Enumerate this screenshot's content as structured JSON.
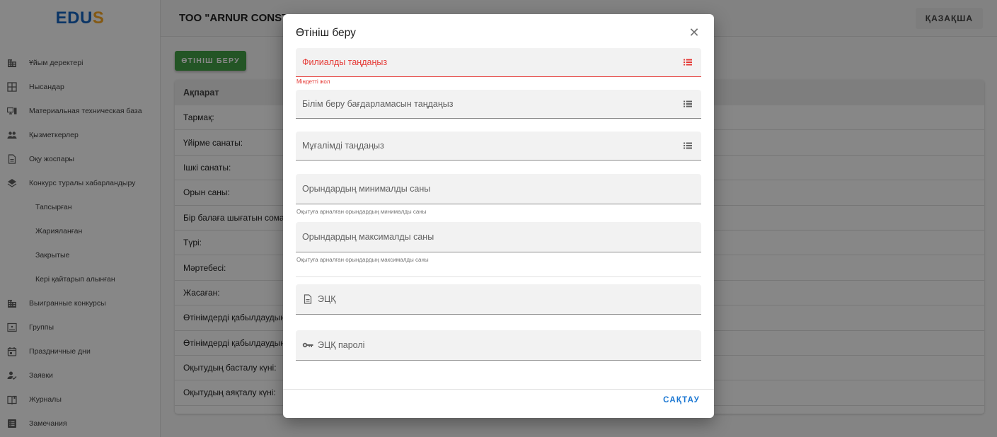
{
  "logo": {
    "e": "E",
    "d": "D",
    "u": "U",
    "s": "S"
  },
  "topbar": {
    "org_title": "ТОО \"ARNUR CONSTRUCTION\"",
    "lang_label": "ҚАЗАҚША"
  },
  "sidebar": {
    "items": [
      {
        "label": "Ұйым деректері",
        "icon": "building-icon"
      },
      {
        "label": "Нысандар",
        "icon": "grid-icon"
      },
      {
        "label": "Материальная техническая база",
        "icon": "devices-icon"
      },
      {
        "label": "Қызметкерлер",
        "icon": "people-icon"
      },
      {
        "label": "Оқу жоспары",
        "icon": "document-icon"
      },
      {
        "label": "Конкурс туралы хабарландыру",
        "icon": "layers-icon"
      },
      {
        "label": "Тапсырған",
        "sub": true
      },
      {
        "label": "Жарияланған",
        "sub": true
      },
      {
        "label": "Закрытые",
        "sub": true
      },
      {
        "label": "Кері қайтарып алынған",
        "sub": true
      },
      {
        "label": "Выигранные конкурсы",
        "icon": "building-icon"
      },
      {
        "label": "Группы",
        "icon": "class-icon"
      },
      {
        "label": "Праздничные дни",
        "icon": "calendar-icon"
      },
      {
        "label": "Заявки",
        "icon": "person-check-icon"
      },
      {
        "label": "Журналы",
        "icon": "book-icon"
      },
      {
        "label": "Замечания",
        "icon": "list-box-icon"
      }
    ]
  },
  "main": {
    "apply_button": "ӨТІНІШ БЕРУ",
    "info_header": "Ақпарат",
    "info_rows": [
      "Тармақ:",
      "Үйірме санаты:",
      "Ішкі санаты:",
      "Орын саны:",
      "Бір балаға шығатын сома",
      "Түрі:",
      "Мәртебесі:",
      "Жасаған:",
      "Өтінімдерді қабылдаудың",
      "Өтінімдерді қабылдаудың",
      "Оқытудың басталу күні:",
      "Оқытудың аяқталу күні:"
    ]
  },
  "modal": {
    "title": "Өтініш беру",
    "close_symbol": "✕",
    "branch_placeholder": "Филиалды таңдаңыз",
    "branch_error": "Міндетті жол",
    "program_placeholder": "Білім беру бағдарламасын таңдаңыз",
    "teacher_placeholder": "Мұғалімді таңдаңыз",
    "min_places_placeholder": "Орындардың минималды саны",
    "min_places_hint": "Оқытуға арналған орындардың минималды саны",
    "max_places_placeholder": "Орындардың максималды саны",
    "max_places_hint": "Оқытуға арналған орындардың максималды саны",
    "eds_label": "ЭЦҚ",
    "eds_password_label": "ЭЦҚ паролі",
    "save_button": "САҚТАУ"
  },
  "colors": {
    "primary": "#1976d2",
    "success": "#43a047",
    "error": "#e53935",
    "logo_blue": "#1565c0",
    "logo_yellow": "#f9a825"
  }
}
